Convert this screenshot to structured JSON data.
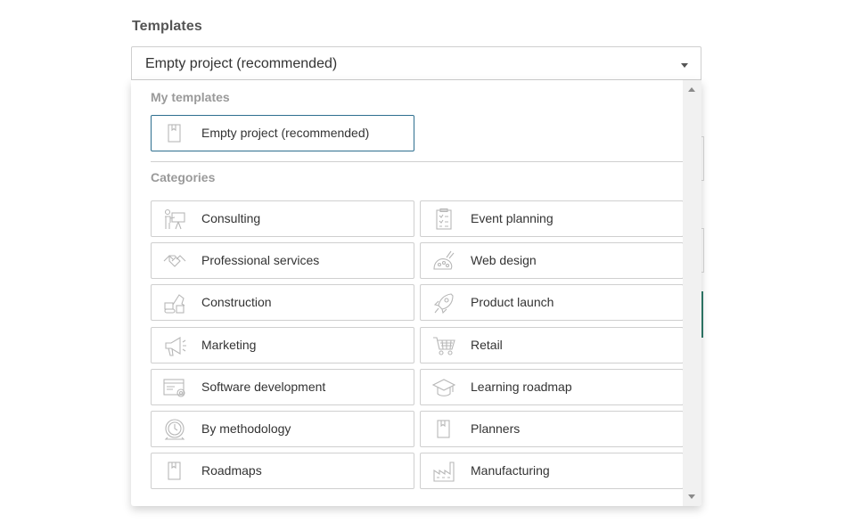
{
  "field": {
    "label": "Templates",
    "selected_value": "Empty project (recommended)"
  },
  "dropdown": {
    "my_templates_title": "My templates",
    "my_templates": [
      {
        "label": "Empty project (recommended)",
        "icon": "blank-page-icon"
      }
    ],
    "categories_title": "Categories",
    "categories": [
      {
        "label": "Consulting",
        "icon": "presenter-icon"
      },
      {
        "label": "Event planning",
        "icon": "clipboard-checklist-icon"
      },
      {
        "label": "Professional services",
        "icon": "handshake-icon"
      },
      {
        "label": "Web design",
        "icon": "palette-brush-icon"
      },
      {
        "label": "Construction",
        "icon": "excavator-icon"
      },
      {
        "label": "Product launch",
        "icon": "rocket-icon"
      },
      {
        "label": "Marketing",
        "icon": "megaphone-icon"
      },
      {
        "label": "Retail",
        "icon": "shopping-cart-icon"
      },
      {
        "label": "Software development",
        "icon": "browser-gear-icon"
      },
      {
        "label": "Learning roadmap",
        "icon": "graduation-cap-icon"
      },
      {
        "label": "By methodology",
        "icon": "timer-icon"
      },
      {
        "label": "Planners",
        "icon": "blank-page-icon"
      },
      {
        "label": "Roadmaps",
        "icon": "blank-page-icon"
      },
      {
        "label": "Manufacturing",
        "icon": "factory-icon"
      }
    ]
  },
  "colors": {
    "selected_border": "#2e6f8f",
    "accent_behind": "#2f7a6a"
  }
}
